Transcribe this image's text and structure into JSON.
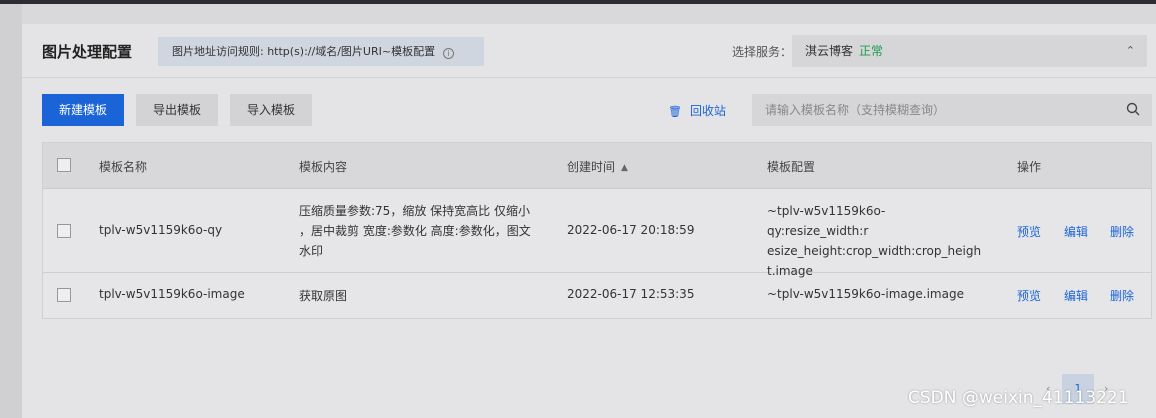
{
  "header": {
    "title": "图片处理配置",
    "rule_text": "图片地址访问规则: http(s)://域名/图片URI~模板配置",
    "service_label": "选择服务：",
    "service_value": "淇云博客",
    "service_status": "正常",
    "colors": {
      "status_ok": "#1a9e4a",
      "accent": "#1a64d8"
    }
  },
  "toolbar": {
    "new_label": "新建模板",
    "export_label": "导出模板",
    "import_label": "导入模板",
    "recycle_label": "回收站",
    "search_placeholder": "请输入模板名称（支持模糊查询）"
  },
  "table": {
    "columns": [
      "模板名称",
      "模板内容",
      "创建时间",
      "模板配置",
      "操作"
    ],
    "rows": [
      {
        "name": "tplv-w5v1159k6o-qy",
        "content": [
          "压缩质量参数:75，缩放 保持宽高比 仅缩小",
          "，居中裁剪 宽度:参数化 高度:参数化，图文",
          "水印"
        ],
        "created": "2022-06-17 20:18:59",
        "config": [
          "~tplv-w5v1159k6o-qy:resize_width:r",
          "esize_height:crop_width:crop_heigh",
          "t.image"
        ],
        "actions": [
          "预览",
          "编辑",
          "删除"
        ]
      },
      {
        "name": "tplv-w5v1159k6o-image",
        "content": [
          "获取原图"
        ],
        "created": "2022-06-17 12:53:35",
        "config": [
          "~tplv-w5v1159k6o-image.image"
        ],
        "actions": [
          "预览",
          "编辑",
          "删除"
        ]
      }
    ]
  },
  "pagination": {
    "current_page": "1"
  },
  "watermark": "CSDN @weixin_41113221"
}
